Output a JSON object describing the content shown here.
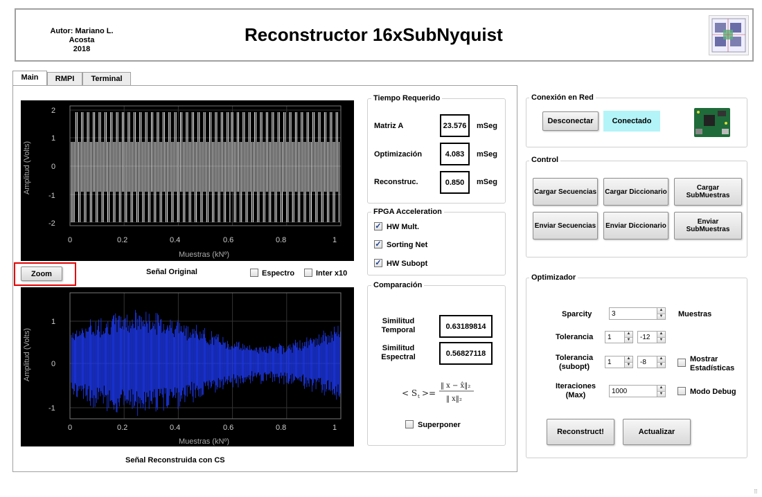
{
  "header": {
    "author_line": "Autor: Mariano L. Acosta",
    "year": "2018",
    "title": "Reconstructor 16xSubNyquist"
  },
  "tabs": [
    "Main",
    "RMPI",
    "Terminal"
  ],
  "plot_top": {
    "ylabel": "Amplitud (Volts)",
    "xlabel": "Muestras (kNº)",
    "yticks": [
      "2",
      "1",
      "0",
      "-1",
      "-2"
    ],
    "xticks": [
      "0",
      "0.2",
      "0.4",
      "0.6",
      "0.8",
      "1"
    ],
    "caption": "Señal Original"
  },
  "plot_bottom": {
    "ylabel": "Amplitud (Volts)",
    "xlabel": "Muestras (kNº)",
    "yticks": [
      "1",
      "0",
      "-1"
    ],
    "xticks": [
      "0",
      "0.2",
      "0.4",
      "0.6",
      "0.8",
      "1"
    ],
    "caption": "Señal Reconstruida con CS"
  },
  "controls_mid": {
    "zoom_label": "Zoom",
    "espectro_label": "Espectro",
    "espectro_checked": false,
    "interx10_label": "Inter x10",
    "interx10_checked": false
  },
  "tiempo": {
    "title": "Tiempo Requerido",
    "rows": [
      {
        "label": "Matriz A",
        "value": "23.576",
        "unit": "mSeg"
      },
      {
        "label": "Optimización",
        "value": "4.083",
        "unit": "mSeg"
      },
      {
        "label": "Reconstruc.",
        "value": "0.850",
        "unit": "mSeg"
      }
    ]
  },
  "fpga": {
    "title": "FPGA Acceleration",
    "items": [
      {
        "label": "HW Mult.",
        "checked": true
      },
      {
        "label": "Sorting Net",
        "checked": true
      },
      {
        "label": "HW Subopt",
        "checked": true
      }
    ]
  },
  "comparacion": {
    "title": "Comparación",
    "sim_temporal_label_1": "Similitud",
    "sim_temporal_label_2": "Temporal",
    "sim_temporal_value": "0.63189814",
    "sim_espectral_label_1": "Similitud",
    "sim_espectral_label_2": "Espectral",
    "sim_espectral_value": "0.56827118",
    "superponer_label": "Superponer",
    "superponer_checked": false
  },
  "red": {
    "title": "Conexión en Red",
    "disconnect_label": "Desconectar",
    "status": "Conectado",
    "status_color": "#b3f4f8"
  },
  "control": {
    "title": "Control",
    "buttons": [
      "Cargar Secuencias",
      "Cargar Diccionario",
      "Cargar SubMuestras",
      "Enviar Secuencias",
      "Enviar Diccionario",
      "Enviar SubMuestras"
    ]
  },
  "optimizador": {
    "title": "Optimizador",
    "sparcity_label": "Sparcity",
    "sparcity_value": "3",
    "sparcity_unit": "Muestras",
    "tolerancia_label": "Tolerancia",
    "tolerancia_mant": "1",
    "tolerancia_exp": "-12",
    "tol_subopt_label_1": "Tolerancia",
    "tol_subopt_label_2": "(subopt)",
    "tol_subopt_mant": "1",
    "tol_subopt_exp": "-8",
    "iter_label_1": "Iteraciones",
    "iter_label_2": "(Max)",
    "iter_value": "1000",
    "mostrar_label_1": "Mostrar",
    "mostrar_label_2": "Estadísticas",
    "mostrar_checked": false,
    "debug_label": "Modo Debug",
    "debug_checked": false,
    "reconstruct_label": "Reconstruct!",
    "actualizar_label": "Actualizar"
  },
  "colors": {
    "plot_bg": "#000000",
    "signal_top": "#ffffff",
    "signal_bottom": "#1f3cff",
    "highlight": "#e00000"
  }
}
